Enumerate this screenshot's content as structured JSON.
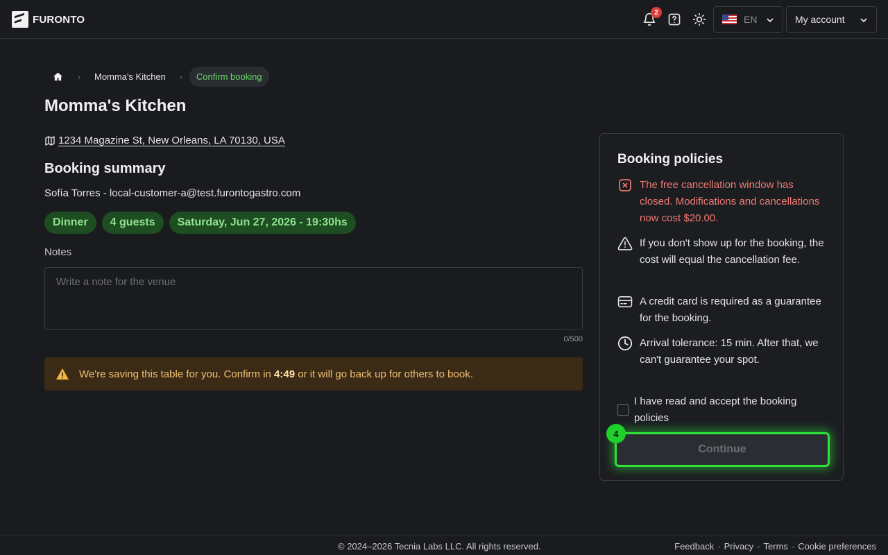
{
  "header": {
    "logo_text": "FURONTO",
    "notifications_count": "2",
    "language": "EN",
    "account_label": "My account"
  },
  "breadcrumb": {
    "items": [
      "Momma's Kitchen",
      "Confirm booking"
    ]
  },
  "venue": {
    "name": "Momma's Kitchen",
    "address": "1234 Magazine St, New Orleans, LA 70130, USA"
  },
  "summary": {
    "title": "Booking summary",
    "customer": "Sofía Torres - local-customer-a@test.furontogastro.com",
    "chips": [
      "Dinner",
      "4 guests",
      "Saturday, Jun 27, 2026 - 19:30hs"
    ]
  },
  "notes": {
    "label": "Notes",
    "placeholder": "Write a note for the venue",
    "value": "",
    "counter": "0/500"
  },
  "hold_alert": {
    "before": "We're saving this table for you. Confirm in ",
    "timer": "4:49",
    "after": " or it will go back up for others to book."
  },
  "policies": {
    "title": "Booking policies",
    "items": [
      {
        "icon": "x-square-icon",
        "text": "The free cancellation window has closed. Modifications and cancellations now cost $20.00."
      },
      {
        "icon": "warning-icon",
        "text": "If you don't show up for the booking, the cost will equal the cancellation fee."
      },
      {
        "icon": "credit-card-icon",
        "text": "A credit card is required as a guarantee for the booking."
      },
      {
        "icon": "clock-icon",
        "text": "Arrival tolerance: 15 min. After that, we can't guarantee your spot."
      }
    ],
    "accept_label": "I have read and accept the booking policies",
    "accepted": false,
    "continue_label": "Continue",
    "step_badge": "4"
  },
  "footer": {
    "copyright": "© 2024–2026 Tecnia Labs LLC. All rights reserved.",
    "links": [
      "Feedback",
      "Privacy",
      "Terms",
      "Cookie preferences"
    ],
    "separator": "-"
  },
  "colors": {
    "background": "#1a1b1e",
    "accent_green": "#2ee23a",
    "chip_bg": "#1e4d21",
    "danger": "#ef7a73",
    "warning_bg": "#3b2a15"
  }
}
